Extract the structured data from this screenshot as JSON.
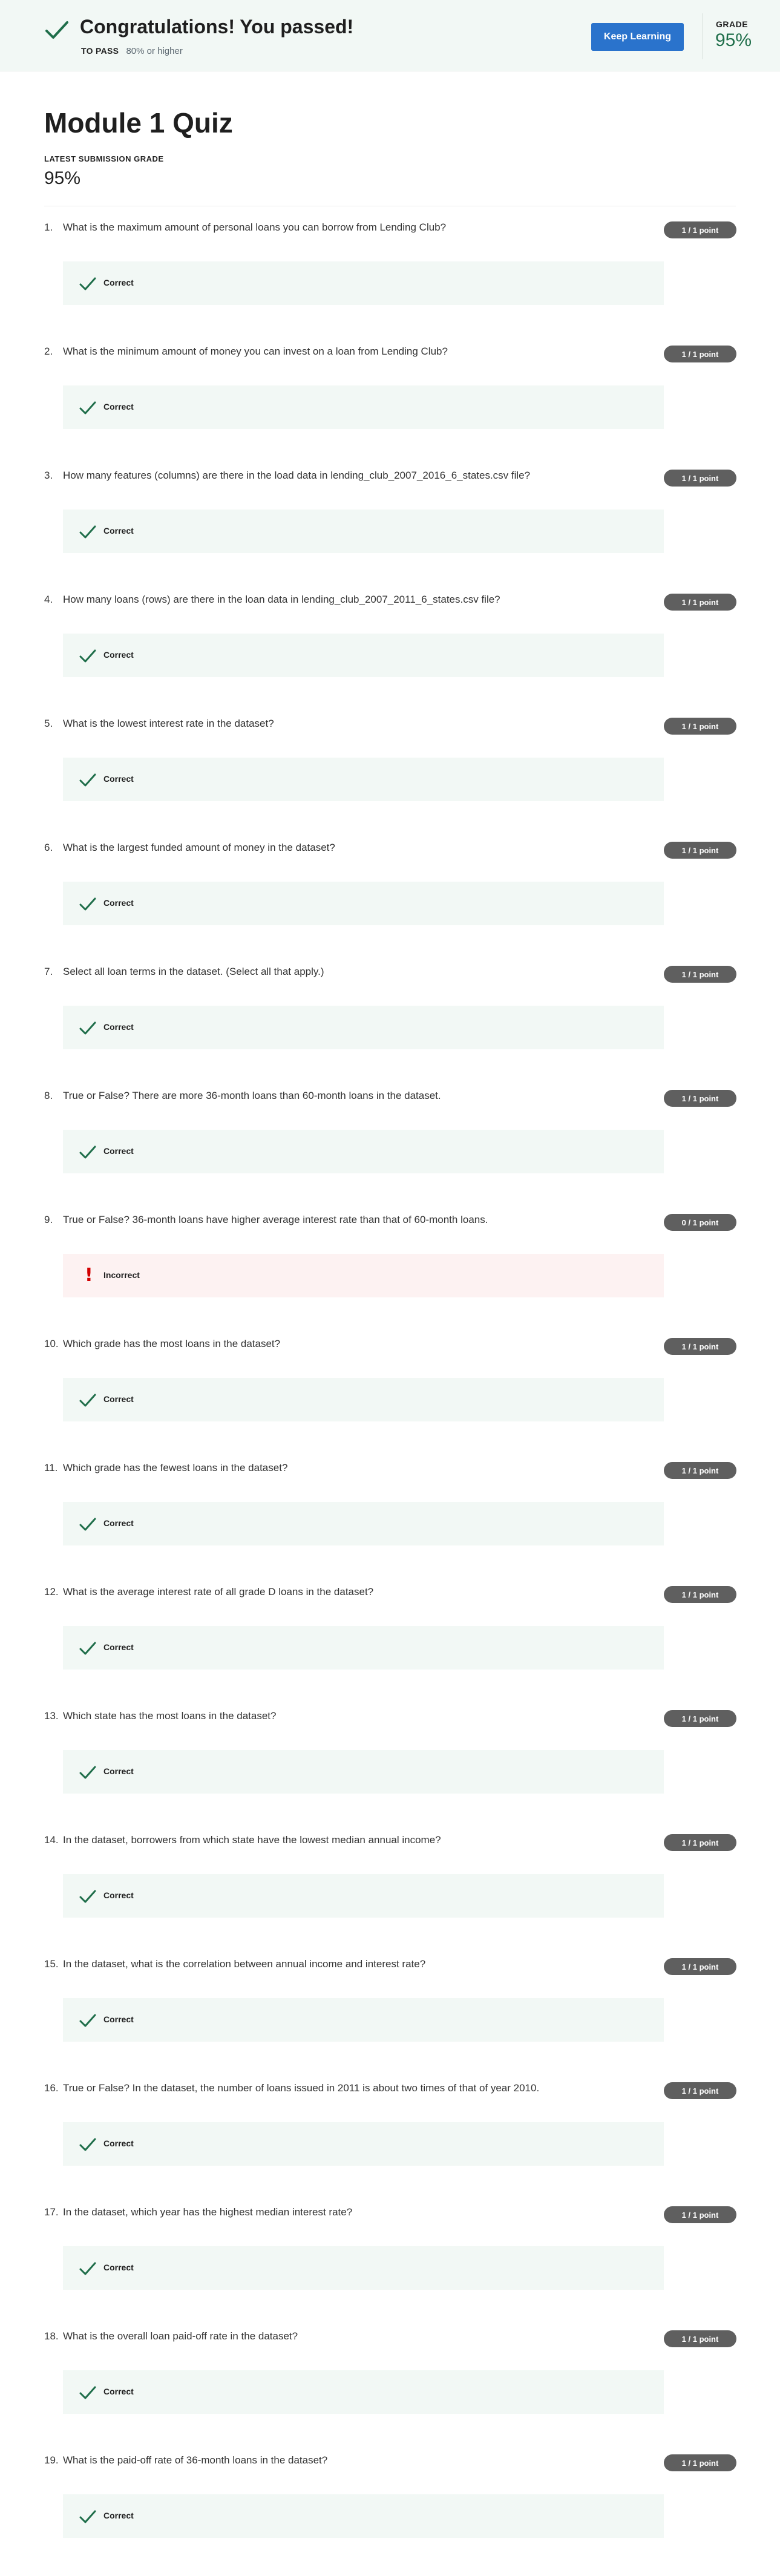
{
  "banner": {
    "title": "Congratulations! You passed!",
    "to_pass_label": "TO PASS",
    "to_pass_value": "80% or higher",
    "keep_learning_label": "Keep Learning",
    "grade_label": "GRADE",
    "grade_value": "95%",
    "icon": "check-icon",
    "accent_color": "#1f6e4a",
    "button_color": "#2a73cc"
  },
  "quiz": {
    "title": "Module 1 Quiz",
    "latest_label": "LATEST SUBMISSION GRADE",
    "latest_value": "95%"
  },
  "questions": [
    {
      "num": "1.",
      "text": "What is the maximum amount of personal loans you can borrow from Lending Club?",
      "points": "1 / 1 point",
      "result": "Correct",
      "status": "correct"
    },
    {
      "num": "2.",
      "text": "What is the minimum amount of money you can invest on a loan from Lending Club?",
      "points": "1 / 1 point",
      "result": "Correct",
      "status": "correct"
    },
    {
      "num": "3.",
      "text": "How many features (columns) are there in the load data in lending_club_2007_2016_6_states.csv file?",
      "points": "1 / 1 point",
      "result": "Correct",
      "status": "correct"
    },
    {
      "num": "4.",
      "text": "How many loans (rows) are there in the loan data in lending_club_2007_2011_6_states.csv file?",
      "points": "1 / 1 point",
      "result": "Correct",
      "status": "correct"
    },
    {
      "num": "5.",
      "text": "What is the lowest interest rate in the dataset?",
      "points": "1 / 1 point",
      "result": "Correct",
      "status": "correct"
    },
    {
      "num": "6.",
      "text": "What is the largest funded amount of money in the dataset?",
      "points": "1 / 1 point",
      "result": "Correct",
      "status": "correct"
    },
    {
      "num": "7.",
      "text": "Select all loan terms in the dataset. (Select all that apply.)",
      "points": "1 / 1 point",
      "result": "Correct",
      "status": "correct"
    },
    {
      "num": "8.",
      "text": "True or False? There are more 36-month loans than 60-month loans in the dataset.",
      "points": "1 / 1 point",
      "result": "Correct",
      "status": "correct"
    },
    {
      "num": "9.",
      "text": "True or False? 36-month loans have higher average interest rate than that of 60-month loans.",
      "points": "0 / 1 point",
      "result": "Incorrect",
      "status": "incorrect"
    },
    {
      "num": "10.",
      "text": "Which grade has the most loans in the dataset?",
      "points": "1 / 1 point",
      "result": "Correct",
      "status": "correct"
    },
    {
      "num": "11.",
      "text": "Which grade has the fewest loans in the dataset?",
      "points": "1 / 1 point",
      "result": "Correct",
      "status": "correct"
    },
    {
      "num": "12.",
      "text": "What is the average interest rate of all grade D loans in the dataset?",
      "points": "1 / 1 point",
      "result": "Correct",
      "status": "correct"
    },
    {
      "num": "13.",
      "text": "Which state has the most loans in the dataset?",
      "points": "1 / 1 point",
      "result": "Correct",
      "status": "correct"
    },
    {
      "num": "14.",
      "text": "In the dataset, borrowers from which state have the lowest median annual income?",
      "points": "1 / 1 point",
      "result": "Correct",
      "status": "correct"
    },
    {
      "num": "15.",
      "text": "In the dataset, what is the correlation between annual income and interest rate?",
      "points": "1 / 1 point",
      "result": "Correct",
      "status": "correct"
    },
    {
      "num": "16.",
      "text": "True or False? In the dataset, the number of loans issued in 2011 is about two times of that of year 2010.",
      "points": "1 / 1 point",
      "result": "Correct",
      "status": "correct"
    },
    {
      "num": "17.",
      "text": "In the dataset, which year has the highest median interest rate?",
      "points": "1 / 1 point",
      "result": "Correct",
      "status": "correct"
    },
    {
      "num": "18.",
      "text": "What is the overall loan paid-off rate in the dataset?",
      "points": "1 / 1 point",
      "result": "Correct",
      "status": "correct"
    },
    {
      "num": "19.",
      "text": "What is the paid-off rate of 36-month loans in the dataset?",
      "points": "1 / 1 point",
      "result": "Correct",
      "status": "correct"
    }
  ]
}
